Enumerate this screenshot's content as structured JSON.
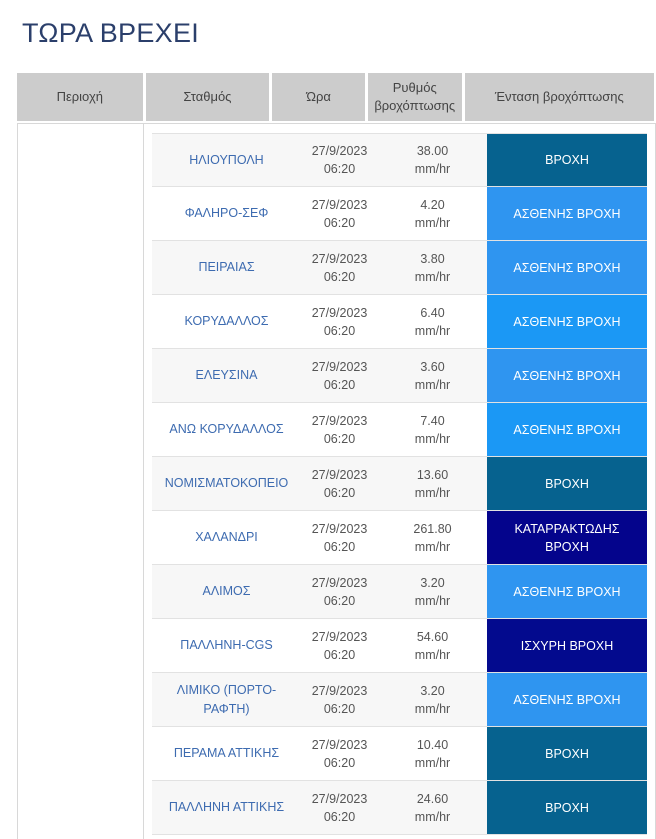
{
  "page": {
    "title": "ΤΩΡΑ ΒΡΕΧΕΙ"
  },
  "table": {
    "headers": {
      "region": "Περιοχή",
      "station": "Σταθμός",
      "time": "Ώρα",
      "rate_line1": "Ρυθμός",
      "rate_line2": "βροχόπτωσης",
      "intensity": "Ένταση βροχόπτωσης"
    },
    "colors": {
      "rain": "#06628f",
      "light_rain": "#2f95f0",
      "heavy_rain": "#030a8e",
      "torrential_rain": "#04048c"
    },
    "rows": [
      {
        "station": "ΗΛΙΟΥΠΟΛΗ",
        "date": "27/9/2023",
        "time": "06:20",
        "rate": "38.00",
        "unit": "mm/hr",
        "intensity": "ΒΡΟΧΗ",
        "color": "#06628f"
      },
      {
        "station": "ΦΑΛΗΡΟ-ΣΕΦ",
        "date": "27/9/2023",
        "time": "06:20",
        "rate": "4.20",
        "unit": "mm/hr",
        "intensity": "ΑΣΘΕΝΗΣ ΒΡΟΧΗ",
        "color": "#2f95f0"
      },
      {
        "station": "ΠΕΙΡΑΙΑΣ",
        "date": "27/9/2023",
        "time": "06:20",
        "rate": "3.80",
        "unit": "mm/hr",
        "intensity": "ΑΣΘΕΝΗΣ ΒΡΟΧΗ",
        "color": "#2f95f0"
      },
      {
        "station": "ΚΟΡΥΔΑΛΛΟΣ",
        "date": "27/9/2023",
        "time": "06:20",
        "rate": "6.40",
        "unit": "mm/hr",
        "intensity": "ΑΣΘΕΝΗΣ ΒΡΟΧΗ",
        "color": "#1b98f5"
      },
      {
        "station": "ΕΛΕΥΣΙΝΑ",
        "date": "27/9/2023",
        "time": "06:20",
        "rate": "3.60",
        "unit": "mm/hr",
        "intensity": "ΑΣΘΕΝΗΣ ΒΡΟΧΗ",
        "color": "#2f95f0"
      },
      {
        "station": "ΑΝΩ ΚΟΡΥΔΑΛΛΟΣ",
        "date": "27/9/2023",
        "time": "06:20",
        "rate": "7.40",
        "unit": "mm/hr",
        "intensity": "ΑΣΘΕΝΗΣ ΒΡΟΧΗ",
        "color": "#1b98f5"
      },
      {
        "station": "ΝΟΜΙΣΜΑΤΟΚΟΠΕΙΟ",
        "date": "27/9/2023",
        "time": "06:20",
        "rate": "13.60",
        "unit": "mm/hr",
        "intensity": "ΒΡΟΧΗ",
        "color": "#06628f"
      },
      {
        "station": "ΧΑΛΑΝΔΡΙ",
        "date": "27/9/2023",
        "time": "06:20",
        "rate": "261.80",
        "unit": "mm/hr",
        "intensity": "ΚΑΤΑΡΡΑΚΤΩΔΗΣ ΒΡΟΧΗ",
        "color": "#04048c"
      },
      {
        "station": "ΑΛΙΜΟΣ",
        "date": "27/9/2023",
        "time": "06:20",
        "rate": "3.20",
        "unit": "mm/hr",
        "intensity": "ΑΣΘΕΝΗΣ ΒΡΟΧΗ",
        "color": "#2f95f0"
      },
      {
        "station": "ΠΑΛΛΗΝΗ-CGS",
        "date": "27/9/2023",
        "time": "06:20",
        "rate": "54.60",
        "unit": "mm/hr",
        "intensity": "ΙΣΧΥΡΗ ΒΡΟΧΗ",
        "color": "#030a8e"
      },
      {
        "station": "ΛΙΜΙΚΟ (ΠΟΡΤΟ-ΡΑΦΤΗ)",
        "date": "27/9/2023",
        "time": "06:20",
        "rate": "3.20",
        "unit": "mm/hr",
        "intensity": "ΑΣΘΕΝΗΣ ΒΡΟΧΗ",
        "color": "#2f95f0"
      },
      {
        "station": "ΠΕΡΑΜΑ ΑΤΤΙΚΗΣ",
        "date": "27/9/2023",
        "time": "06:20",
        "rate": "10.40",
        "unit": "mm/hr",
        "intensity": "ΒΡΟΧΗ",
        "color": "#06628f"
      },
      {
        "station": "ΠΑΛΛΗΝΗ ΑΤΤΙΚΗΣ",
        "date": "27/9/2023",
        "time": "06:20",
        "rate": "24.60",
        "unit": "mm/hr",
        "intensity": "ΒΡΟΧΗ",
        "color": "#06628f"
      }
    ]
  }
}
